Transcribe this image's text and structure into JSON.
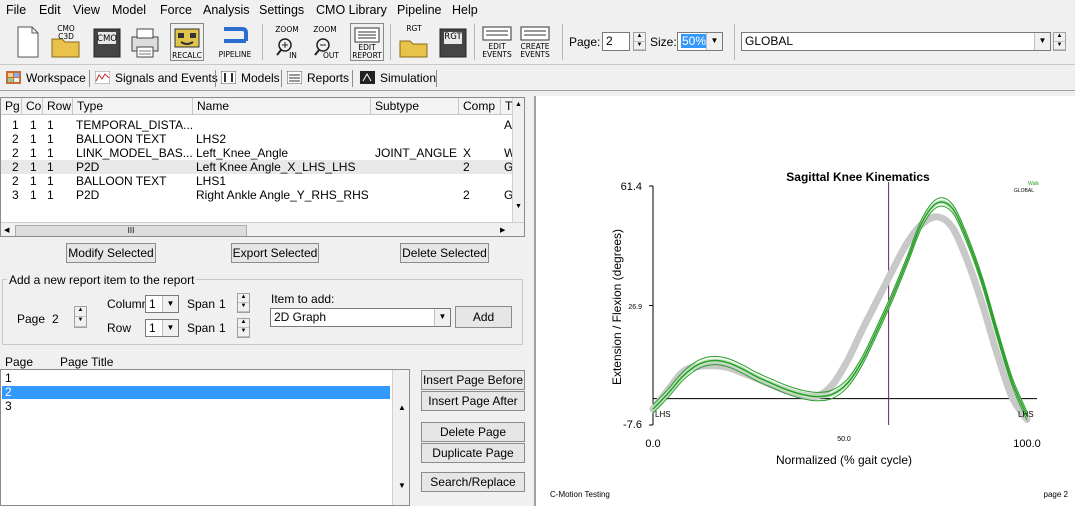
{
  "menu": [
    "File",
    "Edit",
    "View",
    "Model",
    "Force",
    "Analysis",
    "Settings",
    "CMO Library",
    "Pipeline",
    "Help"
  ],
  "toolbar": {
    "new_icon": "new-document-icon",
    "cmo_c3d": "CMO C3D",
    "cmo": "CMO",
    "print_icon": "printer-icon",
    "recalc": "RECALC",
    "pipeline": "PIPELINE",
    "zoom_in_top": "ZOOM",
    "zoom_in_bottom": "IN",
    "zoom_out_top": "ZOOM",
    "zoom_out_bottom": "OUT",
    "edit_report_top": "EDIT",
    "edit_report_bottom": "REPORT",
    "rgt_1": "RGT",
    "rgt_2": "RGT",
    "edit_events_top": "EDIT",
    "edit_events_bottom": "EVENTS",
    "create_events_top": "CREATE",
    "create_events_bottom": "EVENTS",
    "page_label": "Page:",
    "page_value": "2",
    "size_label": "Size:",
    "size_value": "50%",
    "global_value": "GLOBAL"
  },
  "tabs": [
    "Workspace",
    "Signals and Events",
    "Models",
    "Reports",
    "Simulation"
  ],
  "report_table": {
    "headers": [
      "Pg",
      "Col",
      "Row",
      "Type",
      "Name",
      "Subtype",
      "Comp",
      "T"
    ],
    "rows": [
      [
        "1",
        "1",
        "1",
        "TEMPORAL_DISTA...",
        "",
        "",
        "",
        "A"
      ],
      [
        "2",
        "1",
        "1",
        "BALLOON TEXT",
        "LHS2",
        "",
        "",
        ""
      ],
      [
        "2",
        "1",
        "1",
        "LINK_MODEL_BAS...",
        "Left_Knee_Angle",
        "JOINT_ANGLE",
        "X",
        "W"
      ],
      [
        "2",
        "1",
        "1",
        "P2D",
        "Left Knee Angle_X_LHS_LHS",
        "",
        "2",
        "G"
      ],
      [
        "2",
        "1",
        "1",
        "BALLOON TEXT",
        "LHS1",
        "",
        "",
        ""
      ],
      [
        "3",
        "1",
        "1",
        "P2D",
        "Right Ankle Angle_Y_RHS_RHS",
        "",
        "2",
        "G"
      ]
    ],
    "selected_row": 3,
    "scroll_grip": "III"
  },
  "actions": {
    "modify": "Modify Selected",
    "export": "Export Selected",
    "delete": "Delete Selected"
  },
  "add_item": {
    "legend": "Add a new report item to the report",
    "page_label": "Page",
    "page_value": "2",
    "column_label": "Column",
    "column_value": "1",
    "row_label": "Row",
    "row_value": "1",
    "span_label_1": "Span",
    "span_value_1": "1",
    "span_label_2": "Span",
    "span_value_2": "1",
    "item_label": "Item to add:",
    "item_value": "2D Graph",
    "add_button": "Add"
  },
  "pages": {
    "header_page": "Page",
    "header_title": "Page Title",
    "items": [
      "1",
      "2",
      "3"
    ],
    "selected": 1,
    "buttons": [
      "Insert Page Before",
      "Insert Page After",
      "Delete Page",
      "Duplicate Page",
      "Search/Replace"
    ]
  },
  "footer": {
    "left": "C-Motion Testing",
    "right": "page 2"
  },
  "colors": {
    "selection": "#3399ff",
    "green_series": "#2a9d2a",
    "gray_series": "#c8c8c8",
    "vline": "#7a1a6a"
  },
  "chart_data": {
    "type": "line",
    "title": "Sagittal Knee Kinematics",
    "xlabel": "Normalized (% gait cycle)",
    "ylabel": "Extension / Flexion (degrees)",
    "xlim": [
      0,
      100
    ],
    "ylim": [
      -7.6,
      61.4
    ],
    "x_ticks": [
      "0.0",
      "50.0",
      "100.0"
    ],
    "y_ticks": [
      "61.4",
      "26.9",
      "-7.6"
    ],
    "legend": [
      "Walk",
      "GLOBAL"
    ],
    "legend_position": "top-right",
    "event_labels": [
      "LHS",
      "LHS"
    ],
    "event_line_x": 63,
    "series": [
      {
        "name": "Walk",
        "x": [
          0,
          4,
          8,
          12,
          16,
          20,
          24,
          28,
          32,
          36,
          40,
          44,
          48,
          52,
          56,
          60,
          64,
          68,
          72,
          76,
          80,
          84,
          88,
          92,
          96,
          100
        ],
        "values": [
          -3,
          1.5,
          6.5,
          9.8,
          11,
          10.4,
          8.5,
          6.2,
          4.3,
          2.5,
          1.2,
          0.6,
          1.3,
          4.5,
          11,
          20,
          29.5,
          40,
          51,
          56.5,
          55,
          46,
          34,
          19,
          5,
          -5
        ]
      },
      {
        "name": "GLOBAL",
        "x": [
          0,
          4,
          8,
          12,
          16,
          20,
          24,
          28,
          32,
          36,
          40,
          44,
          48,
          52,
          56,
          60,
          64,
          68,
          72,
          76,
          80,
          84,
          88,
          92,
          96,
          100
        ],
        "values": [
          -3,
          2.5,
          7.8,
          9.3,
          9.5,
          9,
          7.4,
          5.7,
          3.8,
          2.2,
          1,
          0.8,
          4,
          11,
          20,
          28.5,
          37,
          45,
          50.5,
          52.5,
          49.5,
          40,
          27.5,
          13,
          0.5,
          -6
        ]
      }
    ]
  }
}
